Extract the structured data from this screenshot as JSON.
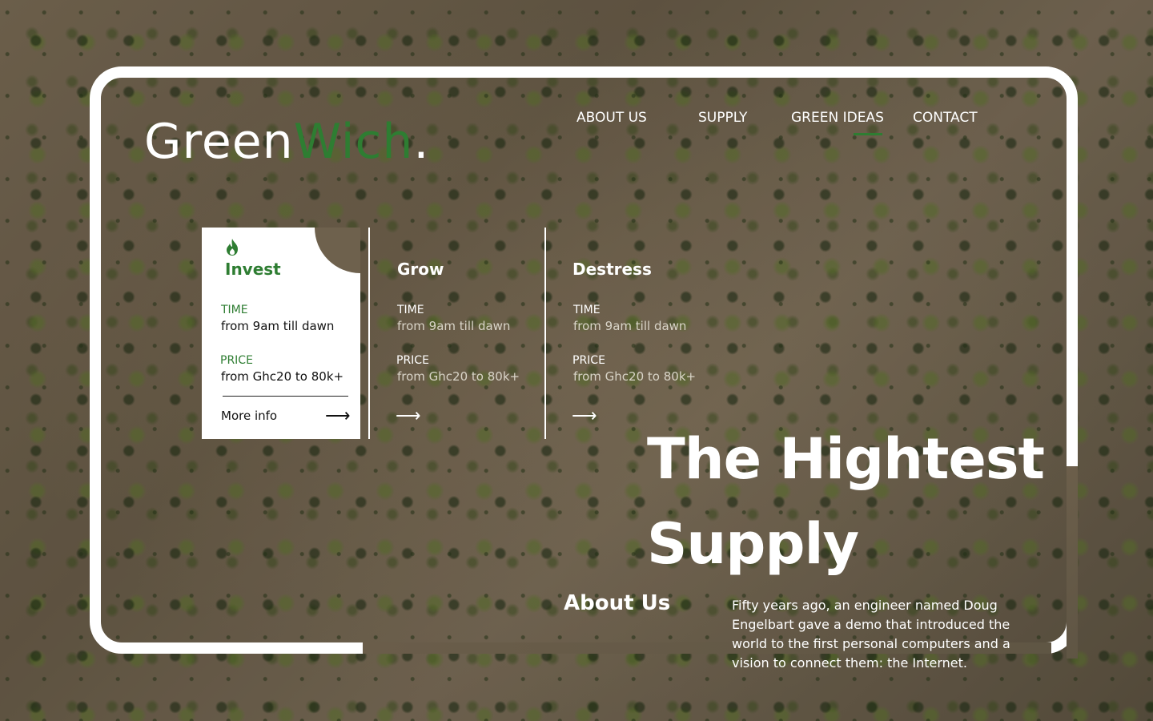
{
  "brand": {
    "part1": "Green",
    "part2": "Wich",
    "dot": "."
  },
  "colors": {
    "accent": "#2e7d32",
    "text_light": "#ffffff",
    "card_bg": "#ffffff"
  },
  "nav": {
    "items": [
      {
        "label": "ABOUT US"
      },
      {
        "label": "SUPPLY"
      },
      {
        "label": "GREEN IDEAS",
        "active": true
      },
      {
        "label": "CONTACT"
      }
    ]
  },
  "cards": [
    {
      "title": "Invest",
      "icon": "flame-icon",
      "time_label": "TIME",
      "time_value": "from 9am till dawn",
      "price_label": "PRICE",
      "price_value": "from Ghc20 to 80k+",
      "link": "More info"
    },
    {
      "title": "Grow",
      "time_label": "TIME",
      "time_value": "from 9am till dawn",
      "price_label": "PRICE",
      "price_value": "from Ghc20 to 80k+"
    },
    {
      "title": "Destress",
      "time_label": "TIME",
      "time_value": "from 9am till dawn",
      "price_label": "PRICE",
      "price_value": "from Ghc20 to 80k+"
    }
  ],
  "hero": {
    "line1": "The Hightest",
    "line2": "Supply"
  },
  "about": {
    "title": "About Us",
    "text": "Fifty years ago, an engineer named Doug Engelbart gave a demo that introduced the world to the first personal computers and a vision to connect them: the Internet."
  }
}
